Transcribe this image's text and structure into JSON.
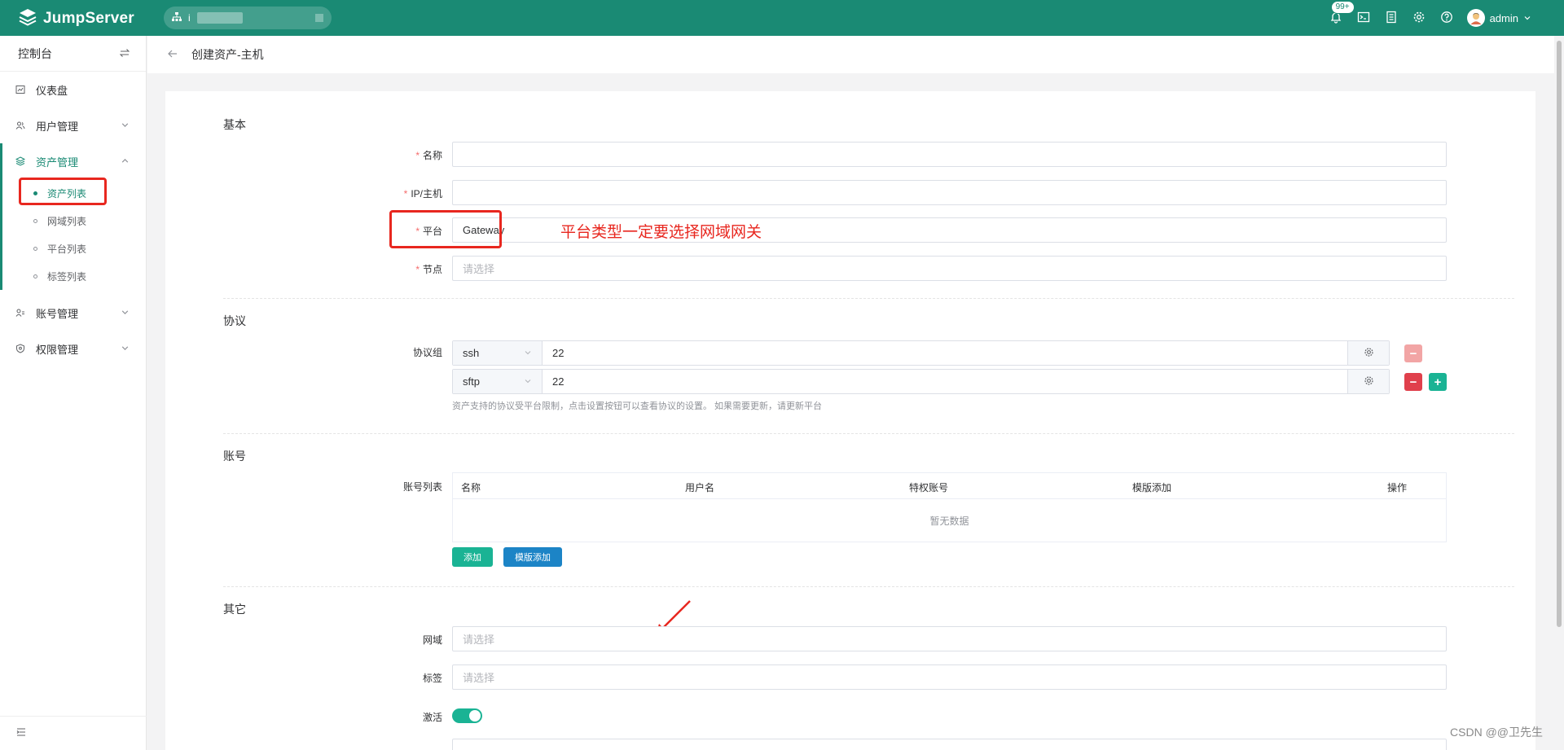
{
  "app": {
    "name": "JumpServer"
  },
  "header": {
    "org_select": {
      "icon": "org-icon",
      "value": "i"
    },
    "notifications_badge": "99+",
    "icons": [
      "bell-icon",
      "terminal-icon",
      "document-icon",
      "gear-icon",
      "help-icon"
    ],
    "user": "admin",
    "brand_color": "#1a8a74"
  },
  "sidebar": {
    "title": "控制台",
    "items": [
      {
        "label": "仪表盘",
        "icon": "dashboard-icon"
      },
      {
        "label": "用户管理",
        "icon": "users-icon"
      },
      {
        "label": "资产管理",
        "icon": "assets-icon",
        "expanded": true,
        "children": [
          "资产列表",
          "网域列表",
          "平台列表",
          "标签列表"
        ]
      },
      {
        "label": "账号管理",
        "icon": "accounts-icon"
      },
      {
        "label": "权限管理",
        "icon": "shield-icon"
      }
    ]
  },
  "page": {
    "title": "创建资产-主机"
  },
  "form": {
    "basic": {
      "title": "基本",
      "name_label": "名称",
      "ip_label": "IP/主机",
      "platform_label": "平台",
      "platform_value": "Gateway",
      "node_label": "节点",
      "node_placeholder": "请选择"
    },
    "protocol": {
      "title": "协议",
      "group_label": "协议组",
      "rows": [
        {
          "name": "ssh",
          "port": "22"
        },
        {
          "name": "sftp",
          "port": "22"
        }
      ],
      "help": "资产支持的协议受平台限制，点击设置按钮可以查看协议的设置。 如果需要更新，请更新平台"
    },
    "account": {
      "title": "账号",
      "list_label": "账号列表",
      "columns": [
        "名称",
        "用户名",
        "特权账号",
        "模版添加",
        "操作"
      ],
      "empty": "暂无数据",
      "add_button": "添加",
      "template_add_button": "模版添加"
    },
    "other": {
      "title": "其它",
      "domain_label": "网域",
      "domain_placeholder": "请选择",
      "labels_label": "标签",
      "labels_placeholder": "请选择",
      "active_label": "激活",
      "active": true
    }
  },
  "annotation": {
    "text": "平台类型一定要选择网域网关",
    "color": "#e8271f"
  },
  "watermark": "CSDN @@卫先生"
}
